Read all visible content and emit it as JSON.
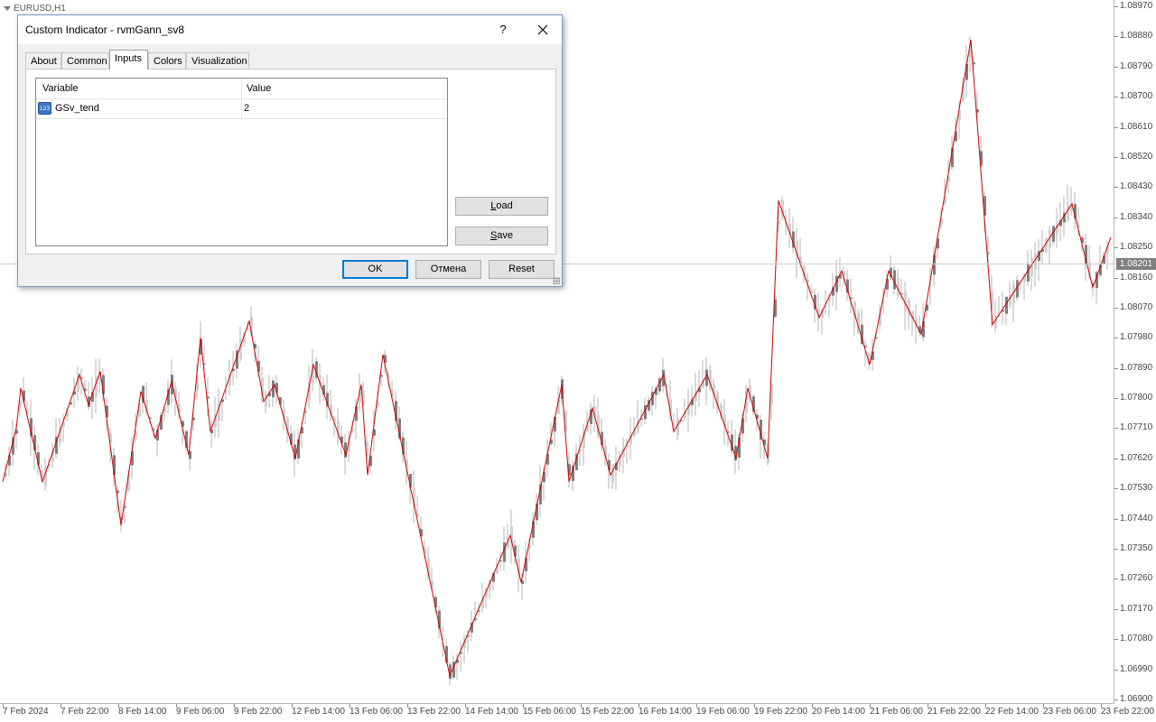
{
  "chart": {
    "symbol": "EURUSD,H1",
    "current_price": "1.08201",
    "price_axis": [
      "1.08970",
      "1.08880",
      "1.08790",
      "1.08700",
      "1.08610",
      "1.08520",
      "1.08430",
      "1.08340",
      "1.08250",
      "1.08160",
      "1.08070",
      "1.07980",
      "1.07890",
      "1.07800",
      "1.07710",
      "1.07620",
      "1.07530",
      "1.07440",
      "1.07350",
      "1.07260",
      "1.07170",
      "1.07080",
      "1.06990",
      "1.06900"
    ],
    "time_axis": [
      "7 Feb 2024",
      "7 Feb 22:00",
      "8 Feb 14:00",
      "9 Feb 06:00",
      "9 Feb 22:00",
      "12 Feb 14:00",
      "13 Feb 06:00",
      "13 Feb 22:00",
      "14 Feb 14:00",
      "15 Feb 06:00",
      "15 Feb 22:00",
      "16 Feb 14:00",
      "19 Feb 06:00",
      "19 Feb 22:00",
      "20 Feb 14:00",
      "21 Feb 06:00",
      "21 Feb 22:00",
      "22 Feb 14:00",
      "23 Feb 06:00",
      "23 Feb 22:00"
    ],
    "zigzag_color": "#cc0000",
    "candle_color": "#7f7f7f"
  },
  "chart_data": {
    "type": "line",
    "title": "EURUSD,H1",
    "ylim": [
      1.069,
      1.0897
    ],
    "series": [
      {
        "name": "rvmGann_sv8",
        "x": [
          "7 Feb 2024",
          "7 Feb 03:00",
          "7 Feb 06:00",
          "7 Feb 12:00",
          "7 Feb 18:00",
          "8 Feb 00:00",
          "8 Feb 03:00",
          "8 Feb 09:00",
          "8 Feb 14:00",
          "8 Feb 18:00",
          "8 Feb 22:00",
          "9 Feb 03:00",
          "9 Feb 06:00",
          "9 Feb 10:00",
          "9 Feb 14:00",
          "9 Feb 20:00",
          "9 Feb 22:00",
          "12 Feb 02:00",
          "12 Feb 05:00",
          "12 Feb 10:00",
          "12 Feb 14:00",
          "12 Feb 19:00",
          "12 Feb 22:00",
          "13 Feb 02:00",
          "13 Feb 06:00",
          "14 Feb 07:00",
          "14 Feb 18:00",
          "15 Feb 00:00",
          "15 Feb 10:00",
          "15 Feb 16:00",
          "15 Feb 20:00",
          "16 Feb 01:00",
          "16 Feb 14:00",
          "16 Feb 18:00",
          "19 Feb 00:00",
          "19 Feb 02:00",
          "19 Feb 06:00",
          "19 Feb 12:00",
          "19 Feb 18:00",
          "20 Feb 06:00",
          "20 Feb 12:00",
          "20 Feb 19:00",
          "21 Feb 01:00",
          "21 Feb 06:00",
          "21 Feb 22:00",
          "22 Feb 07:00",
          "23 Feb 00:00"
        ],
        "values": [
          1.0755,
          1.0771,
          1.0783,
          1.0755,
          1.0787,
          1.0778,
          1.0788,
          1.0742,
          1.0782,
          1.0768,
          1.0785,
          1.0763,
          1.0798,
          1.077,
          1.0803,
          1.0779,
          1.0784,
          1.0762,
          1.079,
          1.0763,
          1.0784,
          1.0757,
          1.0793,
          1.0697,
          1.0739,
          1.0725,
          1.0784,
          1.0755,
          1.0777,
          1.0757,
          1.0787,
          1.077,
          1.0787,
          1.0762,
          1.0783,
          1.0762,
          1.0839,
          1.0804,
          1.0818,
          1.079,
          1.0818,
          1.0799,
          1.0887,
          1.0802,
          1.0838,
          1.0813,
          1.0828
        ]
      }
    ]
  },
  "dialog": {
    "title": "Custom Indicator - rvmGann_sv8",
    "help_label": "?",
    "close_label": "✕",
    "tabs": [
      "About",
      "Common",
      "Inputs",
      "Colors",
      "Visualization"
    ],
    "active_tab": "Inputs",
    "grid": {
      "headers": [
        "Variable",
        "Value"
      ],
      "rows": [
        {
          "icon": "integer-variable-icon",
          "icon_text": "123",
          "variable": "GSv_tend",
          "value": "2"
        }
      ]
    },
    "buttons": {
      "load_rest": "oad",
      "load_mnemonic": "L",
      "save_rest": "ave",
      "save_mnemonic": "S",
      "ok": "OK",
      "cancel": "Отмена",
      "reset": "Reset"
    }
  }
}
